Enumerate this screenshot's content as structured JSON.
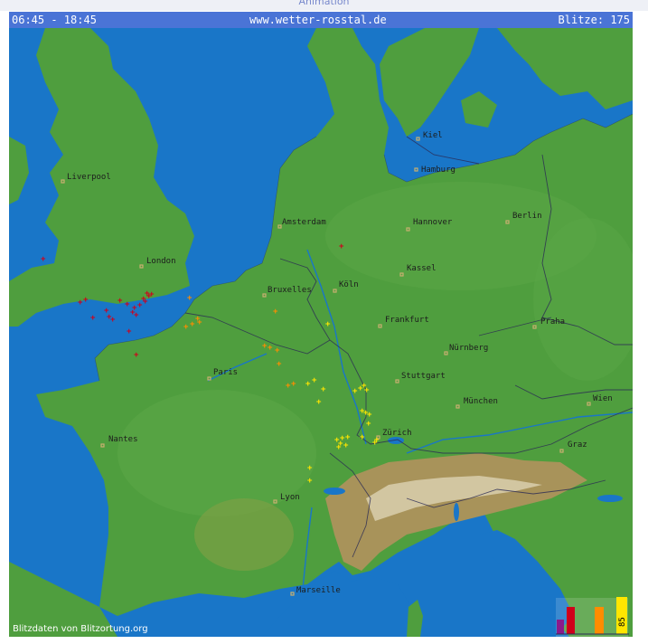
{
  "topbar": {
    "animation_label": "Animation"
  },
  "header": {
    "time_range": "06:45 - 18:45",
    "site": "www.wetter-rosstal.de",
    "strikes_label": "Blitze: 175"
  },
  "credit": "Blitzdaten von Blitzortung.org",
  "cities": [
    {
      "name": "Kiel"
    },
    {
      "name": "Hamburg"
    },
    {
      "name": "Liverpool"
    },
    {
      "name": "Amsterdam"
    },
    {
      "name": "Hannover"
    },
    {
      "name": "Berlin"
    },
    {
      "name": "London"
    },
    {
      "name": "Kassel"
    },
    {
      "name": "Bruxelles"
    },
    {
      "name": "Köln"
    },
    {
      "name": "Frankfurt"
    },
    {
      "name": "Praha"
    },
    {
      "name": "Paris"
    },
    {
      "name": "Nürnberg"
    },
    {
      "name": "Stuttgart"
    },
    {
      "name": "Wien"
    },
    {
      "name": "München"
    },
    {
      "name": "Nantes"
    },
    {
      "name": "Zürich"
    },
    {
      "name": "Graz"
    },
    {
      "name": "Lyon"
    },
    {
      "name": "Marseille"
    }
  ],
  "histogram_label": "85",
  "colors": {
    "sea": "#1976c8",
    "land": "#4f9e3e",
    "land_light": "#67b34f",
    "mountain": "#a8935a",
    "snow": "#d9cfae",
    "header": "#4a74d6",
    "border": "#2b2b55",
    "strike_old": "#d0001a",
    "strike_mid": "#ff8c00",
    "strike_new": "#ffe600"
  }
}
